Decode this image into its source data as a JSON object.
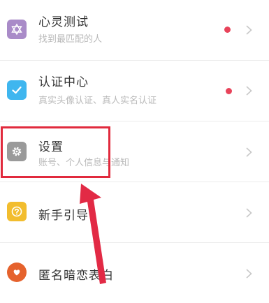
{
  "colors": {
    "badge": "#e8435a",
    "highlight": "#e12a3d",
    "arrow": "#e22a45"
  },
  "items": [
    {
      "title": "心灵测试",
      "subtitle": "找到最匹配的人",
      "icon": "star-of-david-icon",
      "icon_color": "#a98bc8",
      "badge": true
    },
    {
      "title": "认证中心",
      "subtitle": "真实头像认证、真人实名认证",
      "icon": "checkmark-icon",
      "icon_color": "#3fb6ef",
      "badge": true
    },
    {
      "title": "设置",
      "subtitle": "账号、个人信息与通知",
      "icon": "gear-icon",
      "icon_color": "#9a9a9a",
      "badge": false
    },
    {
      "title": "新手引导",
      "subtitle": "",
      "icon": "question-mark-icon",
      "icon_color": "#f2bd2e",
      "badge": false
    },
    {
      "title": "匿名暗恋表白",
      "subtitle": "",
      "icon": "heart-chat-bubble-icon",
      "icon_color": "#e5622d",
      "badge": false
    }
  ]
}
